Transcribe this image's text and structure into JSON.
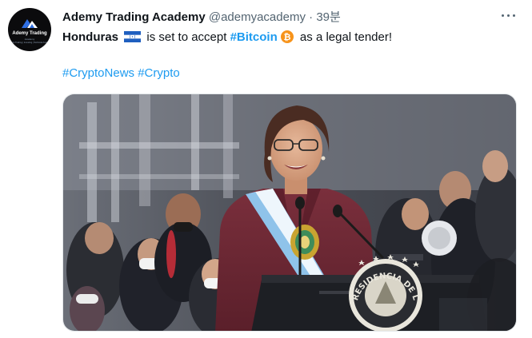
{
  "tweet": {
    "avatar": {
      "brand": "Ademy Trading",
      "sub": "Academy",
      "tagline": "Crypto Trading | Investing | Technical Analysis"
    },
    "author_name": "Ademy Trading Academy",
    "handle": "@ademyacademy",
    "separator": "·",
    "time": "39분",
    "text": {
      "subject": "Honduras",
      "before_hashtag": " is set to accept ",
      "hashtag_bitcoin": "#Bitcoin",
      "after_icon": " as a legal tender!"
    },
    "hashtags": [
      "#CryptoNews",
      "#Crypto"
    ],
    "media": {
      "podium_seal_text": "PRESIDENCIA DE LA"
    },
    "icons": {
      "flag": "honduras-flag-icon",
      "coin": "bitcoin-icon",
      "more": "more-options-icon"
    },
    "colors": {
      "link": "#1d9bf0",
      "text": "#0f1419",
      "muted": "#536471",
      "bitcoin": "#f7931a",
      "flag_blue": "#1f5fbf"
    }
  }
}
